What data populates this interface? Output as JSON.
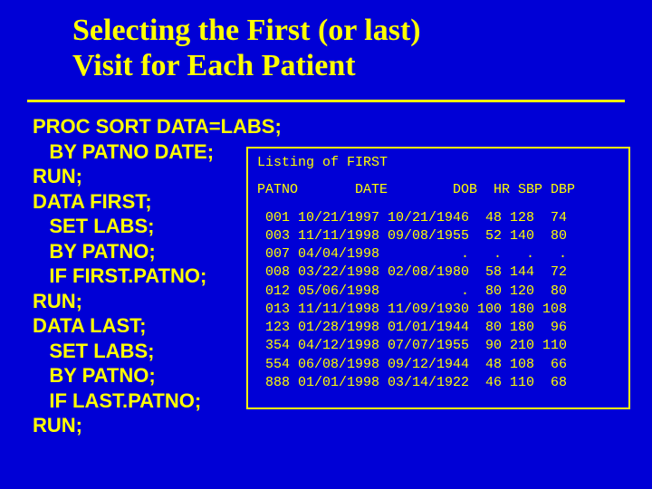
{
  "title_line1": "Selecting the First (or last)",
  "title_line2": "Visit for Each Patient",
  "code": "PROC SORT DATA=LABS;\n   BY PATNO DATE;\nRUN;\nDATA FIRST;\n   SET LABS;\n   BY PATNO;\n   IF FIRST.PATNO;\nRUN;\nDATA LAST;\n   SET LABS;\n   BY PATNO;\n   IF LAST.PATNO;\nRUN;",
  "listing": {
    "title": "Listing of FIRST",
    "header": "PATNO       DATE        DOB  HR SBP DBP",
    "rows": [
      " 001 10/21/1997 10/21/1946  48 128  74",
      " 003 11/11/1998 09/08/1955  52 140  80",
      " 007 04/04/1998          .   .   .   .",
      " 008 03/22/1998 02/08/1980  58 144  72",
      " 012 05/06/1998          .  80 120  80",
      " 013 11/11/1998 11/09/1930 100 180 108",
      " 123 01/28/1998 01/01/1944  80 180  96",
      " 354 04/12/1998 07/07/1955  90 210 110",
      " 554 06/08/1998 09/12/1944  48 108  66",
      " 888 01/01/1998 03/14/1922  46 110  68"
    ]
  }
}
